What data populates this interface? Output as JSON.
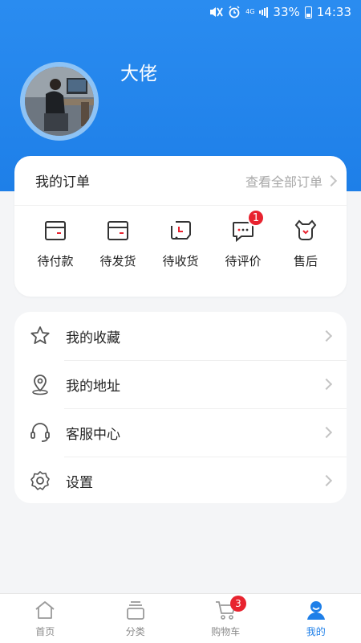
{
  "status_bar": {
    "network": "4G",
    "battery": "33%",
    "time": "14:33"
  },
  "profile": {
    "username": "大佬"
  },
  "orders": {
    "title": "我的订单",
    "view_all": "查看全部订单",
    "items": [
      {
        "label": "待付款",
        "icon": "wallet-icon"
      },
      {
        "label": "待发货",
        "icon": "wallet-icon"
      },
      {
        "label": "待收货",
        "icon": "receive-icon"
      },
      {
        "label": "待评价",
        "icon": "comment-icon",
        "badge": "1"
      },
      {
        "label": "售后",
        "icon": "wrench-icon"
      }
    ]
  },
  "menu": {
    "items": [
      {
        "label": "我的收藏",
        "icon": "star-icon"
      },
      {
        "label": "我的地址",
        "icon": "location-icon"
      },
      {
        "label": "客服中心",
        "icon": "headset-icon"
      },
      {
        "label": "设置",
        "icon": "gear-icon"
      }
    ]
  },
  "tabbar": {
    "items": [
      {
        "label": "首页",
        "icon": "home-icon"
      },
      {
        "label": "分类",
        "icon": "category-icon"
      },
      {
        "label": "购物车",
        "icon": "cart-icon",
        "badge": "3"
      },
      {
        "label": "我的",
        "icon": "user-icon",
        "active": true
      }
    ]
  },
  "colors": {
    "primary": "#1e7fe8",
    "badge": "#e8232f",
    "accent_red": "#e8232f"
  }
}
